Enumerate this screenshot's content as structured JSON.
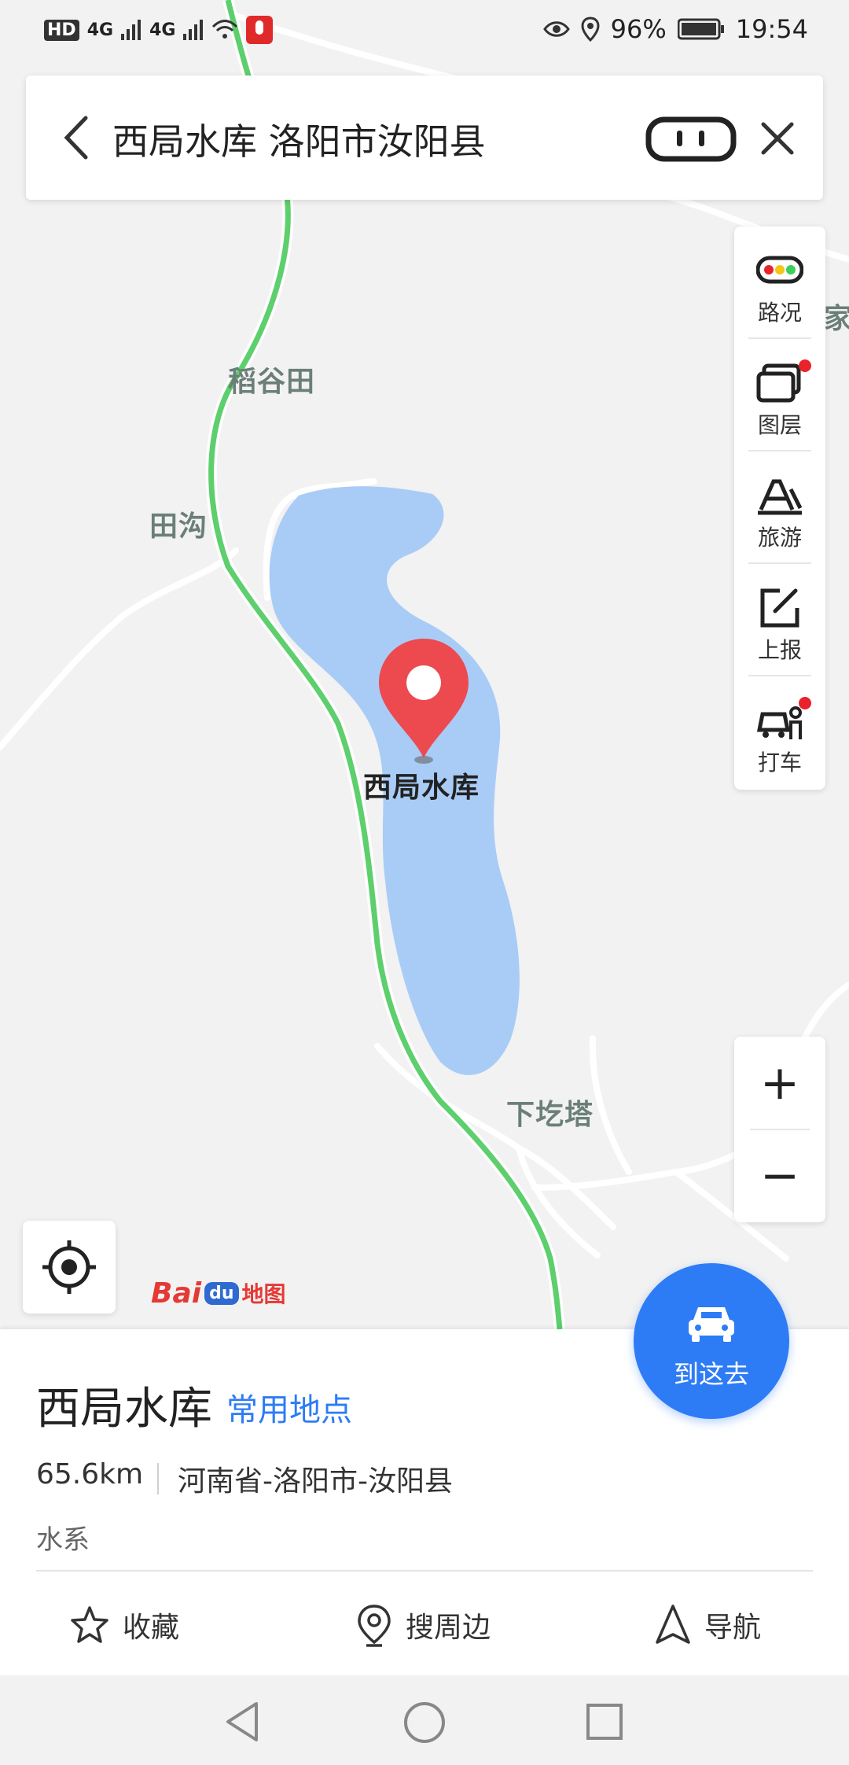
{
  "status_bar": {
    "left_badges": [
      "HD",
      "4G",
      "4G"
    ],
    "battery": "96%",
    "time": "19:54"
  },
  "search": {
    "query": "西局水库 洛阳市汝阳县"
  },
  "map": {
    "places": [
      {
        "name": "稻谷田"
      },
      {
        "name": "田沟"
      },
      {
        "name": "下圪塔"
      },
      {
        "name": "家"
      }
    ],
    "marker_label": "西局水库",
    "logo": {
      "bai": "Bai",
      "du": "du",
      "map": "地图"
    }
  },
  "tools": [
    {
      "label": "路况",
      "icon": "traffic-icon"
    },
    {
      "label": "图层",
      "icon": "layers-icon"
    },
    {
      "label": "旅游",
      "icon": "travel-icon"
    },
    {
      "label": "上报",
      "icon": "report-icon"
    },
    {
      "label": "打车",
      "icon": "taxi-icon"
    }
  ],
  "zoom": {
    "in": "+",
    "out": "−"
  },
  "poi": {
    "name": "西局水库",
    "tag": "常用地点",
    "distance": "65.6km",
    "address": "河南省-洛阳市-汝阳县",
    "category": "水系"
  },
  "go_button": {
    "label": "到这去"
  },
  "actions": [
    {
      "label": "收藏",
      "icon": "star-icon"
    },
    {
      "label": "搜周边",
      "icon": "pin-search-icon"
    },
    {
      "label": "导航",
      "icon": "navigate-icon"
    }
  ],
  "colors": {
    "accent": "#2d7cf6",
    "water": "#a9ccf7",
    "road_green": "#5dcf6c",
    "marker_red": "#ec4a4f"
  }
}
